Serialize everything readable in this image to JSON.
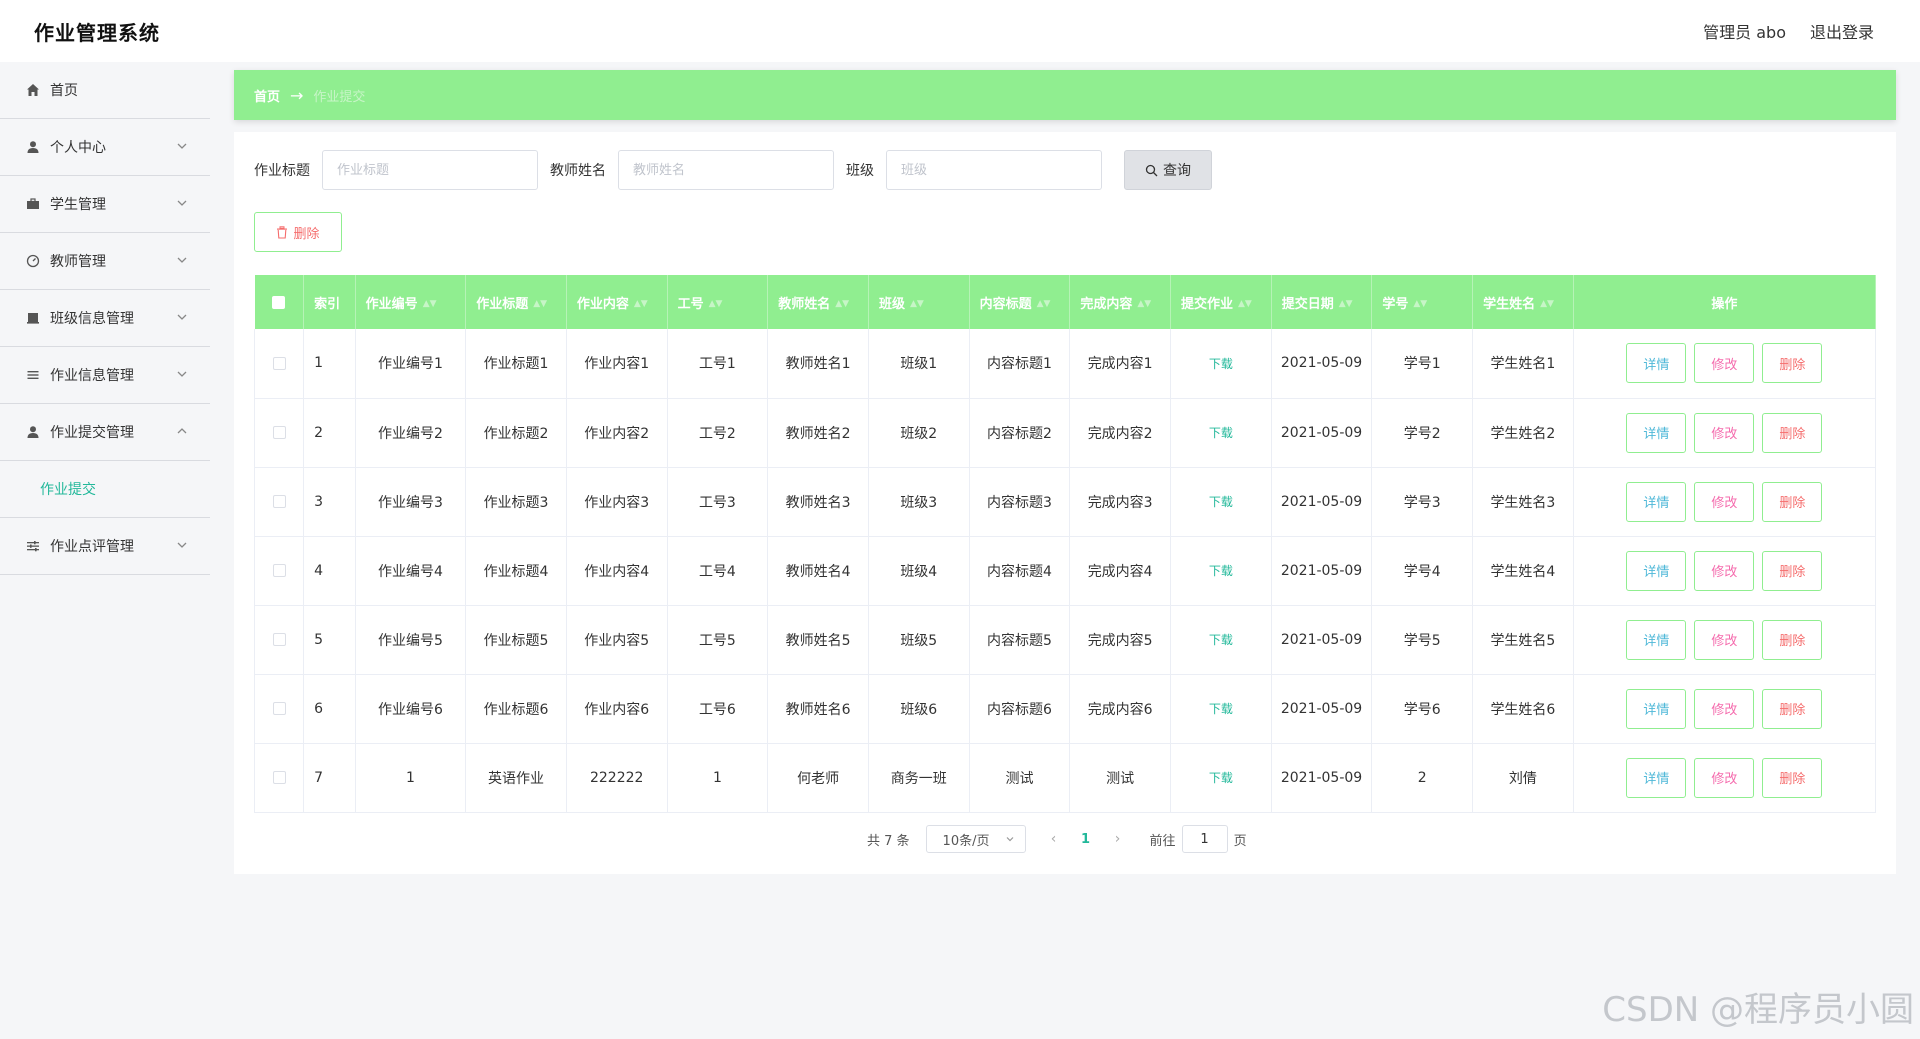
{
  "header": {
    "title": "作业管理系统",
    "user": "管理员 abo",
    "logout": "退出登录"
  },
  "sidebar": {
    "items": [
      {
        "label": "首页",
        "icon": "home-icon"
      },
      {
        "label": "个人中心",
        "icon": "user-icon"
      },
      {
        "label": "学生管理",
        "icon": "briefcase-icon"
      },
      {
        "label": "教师管理",
        "icon": "dashboard-icon"
      },
      {
        "label": "班级信息管理",
        "icon": "printer-icon"
      },
      {
        "label": "作业信息管理",
        "icon": "list-icon"
      },
      {
        "label": "作业提交管理",
        "icon": "user-icon",
        "expanded": true,
        "children": [
          {
            "label": "作业提交"
          }
        ]
      },
      {
        "label": "作业点评管理",
        "icon": "sliders-icon"
      }
    ]
  },
  "breadcrumb": {
    "home": "首页",
    "arrow": "→",
    "current": "作业提交"
  },
  "search": {
    "title_label": "作业标题",
    "title_placeholder": "作业标题",
    "teacher_label": "教师姓名",
    "teacher_placeholder": "教师姓名",
    "class_label": "班级",
    "class_placeholder": "班级",
    "query_button": "查询"
  },
  "actions": {
    "delete_button": "删除"
  },
  "table": {
    "columns": [
      "索引",
      "作业编号",
      "作业标题",
      "作业内容",
      "工号",
      "教师姓名",
      "班级",
      "内容标题",
      "完成内容",
      "提交作业",
      "提交日期",
      "学号",
      "学生姓名",
      "操作"
    ],
    "rows": [
      [
        "1",
        "作业编号1",
        "作业标题1",
        "作业内容1",
        "工号1",
        "教师姓名1",
        "班级1",
        "内容标题1",
        "完成内容1",
        "下载",
        "2021-05-09",
        "学号1",
        "学生姓名1"
      ],
      [
        "2",
        "作业编号2",
        "作业标题2",
        "作业内容2",
        "工号2",
        "教师姓名2",
        "班级2",
        "内容标题2",
        "完成内容2",
        "下载",
        "2021-05-09",
        "学号2",
        "学生姓名2"
      ],
      [
        "3",
        "作业编号3",
        "作业标题3",
        "作业内容3",
        "工号3",
        "教师姓名3",
        "班级3",
        "内容标题3",
        "完成内容3",
        "下载",
        "2021-05-09",
        "学号3",
        "学生姓名3"
      ],
      [
        "4",
        "作业编号4",
        "作业标题4",
        "作业内容4",
        "工号4",
        "教师姓名4",
        "班级4",
        "内容标题4",
        "完成内容4",
        "下载",
        "2021-05-09",
        "学号4",
        "学生姓名4"
      ],
      [
        "5",
        "作业编号5",
        "作业标题5",
        "作业内容5",
        "工号5",
        "教师姓名5",
        "班级5",
        "内容标题5",
        "完成内容5",
        "下载",
        "2021-05-09",
        "学号5",
        "学生姓名5"
      ],
      [
        "6",
        "作业编号6",
        "作业标题6",
        "作业内容6",
        "工号6",
        "教师姓名6",
        "班级6",
        "内容标题6",
        "完成内容6",
        "下载",
        "2021-05-09",
        "学号6",
        "学生姓名6"
      ],
      [
        "7",
        "1",
        "英语作业",
        "222222",
        "1",
        "何老师",
        "商务一班",
        "测试",
        "测试",
        "下载",
        "2021-05-09",
        "2",
        "刘倩"
      ]
    ],
    "row_actions": {
      "detail": "详情",
      "edit": "修改",
      "delete": "删除"
    }
  },
  "pagination": {
    "total": "共 7 条",
    "page_size": "10条/页",
    "current_page": "1",
    "goto_prefix": "前往",
    "goto_value": "1",
    "goto_suffix": "页"
  },
  "watermark": "CSDN @程序员小圆",
  "colors": {
    "accent_green": "#90ee90",
    "teal": "#22b89a",
    "danger": "#f56c6c",
    "edit_pink": "#f56cae",
    "detail_blue": "#4fb8d8"
  }
}
